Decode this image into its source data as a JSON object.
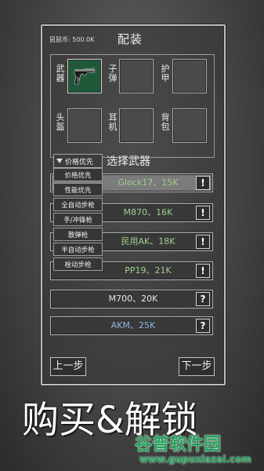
{
  "header": {
    "balance": "鼠鼠币: 500.0K",
    "title": "配装"
  },
  "equipment": {
    "weapon_label": "武器",
    "ammo_label": "子弹",
    "armor_label": "护甲",
    "helmet_label": "头盔",
    "earpiece_label": "耳机",
    "backpack_label": "背包",
    "weapon_icon": "pistol-icon"
  },
  "sort": {
    "current": "价格优先",
    "options": [
      "价格优先",
      "性能优先",
      "全自动步枪",
      "手/冲锋枪",
      "散弹枪",
      "半自动步枪",
      "栓动步枪"
    ]
  },
  "weapon_list": {
    "title": "选择武器",
    "items": [
      {
        "name": "Glock17、15K",
        "status": "!",
        "selected": true
      },
      {
        "name": "M870、16K",
        "status": "!"
      },
      {
        "name": "民用AK、18K",
        "status": "!"
      },
      {
        "name": "PP19、21K",
        "status": "!"
      },
      {
        "name": "M700、20K",
        "status": "?"
      },
      {
        "name": "AKM、25K",
        "status": "?"
      }
    ]
  },
  "nav": {
    "prev": "上一步",
    "next": "下一步"
  },
  "banner": "购买&解锁",
  "watermark": {
    "name": "谷普软件园",
    "url": "www.gupuxlazai.com"
  },
  "colors": {
    "owned": "#9fce8f",
    "available": "#e6e6e6",
    "locked": "#8fb4e0",
    "watermark": "#1fa35a"
  }
}
